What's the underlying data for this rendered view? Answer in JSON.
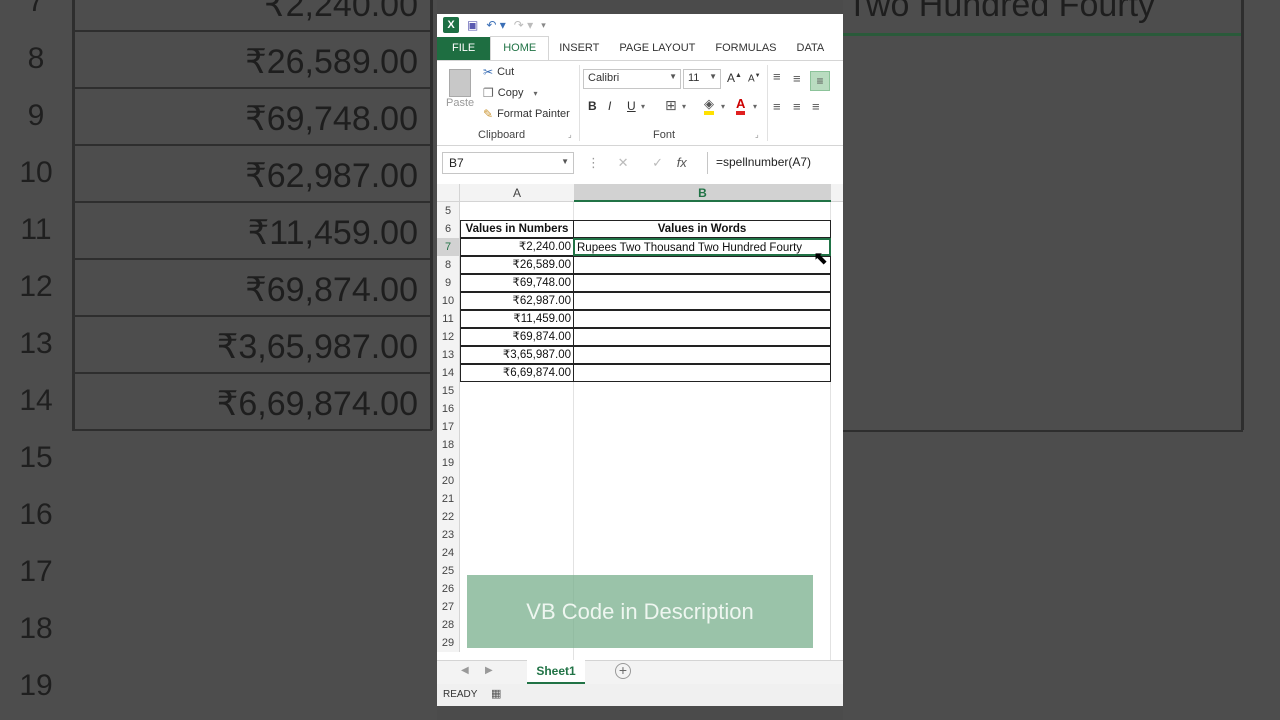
{
  "background": {
    "rows": [
      {
        "num": "7",
        "value": "₹2,240.00"
      },
      {
        "num": "8",
        "value": "₹26,589.00"
      },
      {
        "num": "9",
        "value": "₹69,748.00"
      },
      {
        "num": "10",
        "value": "₹62,987.00"
      },
      {
        "num": "11",
        "value": "₹11,459.00"
      },
      {
        "num": "12",
        "value": "₹69,874.00"
      },
      {
        "num": "13",
        "value": "₹3,65,987.00"
      },
      {
        "num": "14",
        "value": "₹6,69,874.00"
      },
      {
        "num": "15",
        "value": ""
      },
      {
        "num": "16",
        "value": ""
      },
      {
        "num": "17",
        "value": ""
      },
      {
        "num": "18",
        "value": ""
      },
      {
        "num": "19",
        "value": ""
      }
    ],
    "right_text": "Two Hundred Fourty"
  },
  "ribbon": {
    "tabs": [
      "FILE",
      "HOME",
      "INSERT",
      "PAGE LAYOUT",
      "FORMULAS",
      "DATA"
    ],
    "paste": "Paste",
    "cut": "Cut",
    "copy": "Copy",
    "format_painter": "Format Painter",
    "clipboard": "Clipboard",
    "font_name": "Calibri",
    "font_size": "11",
    "font_group": "Font",
    "bold": "B",
    "italic": "I",
    "underline": "U"
  },
  "formula_bar": {
    "name_box": "B7",
    "fx": "fx",
    "formula": "=spellnumber(A7)"
  },
  "grid": {
    "col_a": "A",
    "col_b": "B",
    "header_a": "Values in Numbers",
    "header_b": "Values in Words",
    "rows": [
      {
        "num": "7",
        "a": "₹2,240.00",
        "b": "Rupees Two Thousand Two Hundred Fourty"
      },
      {
        "num": "8",
        "a": "₹26,589.00",
        "b": ""
      },
      {
        "num": "9",
        "a": "₹69,748.00",
        "b": ""
      },
      {
        "num": "10",
        "a": "₹62,987.00",
        "b": ""
      },
      {
        "num": "11",
        "a": "₹11,459.00",
        "b": ""
      },
      {
        "num": "12",
        "a": "₹69,874.00",
        "b": ""
      },
      {
        "num": "13",
        "a": "₹3,65,987.00",
        "b": ""
      },
      {
        "num": "14",
        "a": "₹6,69,874.00",
        "b": ""
      }
    ],
    "empty_rows": [
      "5",
      "15",
      "16",
      "17",
      "18",
      "19",
      "20",
      "21",
      "22",
      "23",
      "24",
      "25",
      "26",
      "27",
      "28",
      "29"
    ],
    "header_row_num": "6",
    "banner": "VB Code in Description"
  },
  "sheet_tab": "Sheet1",
  "status": "READY"
}
